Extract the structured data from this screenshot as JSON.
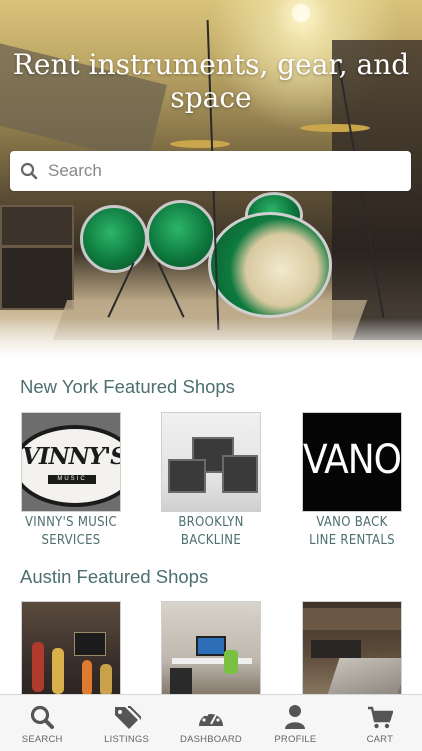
{
  "hero": {
    "title": "Rent instruments, gear, and space"
  },
  "search": {
    "placeholder": "Search",
    "icon": "search-icon"
  },
  "sections": [
    {
      "title": "New York Featured Shops",
      "shops": [
        {
          "name": "VINNY'S MUSIC SERVICES",
          "logo_text": "VINNY'S",
          "logo_sub": "MUSIC"
        },
        {
          "name": "BROOKLYN BACKLINE"
        },
        {
          "name": "VANO BACK LINE RENTALS",
          "logo_text": "VANO"
        }
      ]
    },
    {
      "title": "Austin Featured Shops",
      "shops": [
        {
          "name": ""
        },
        {
          "name": ""
        },
        {
          "name": ""
        }
      ]
    }
  ],
  "tabbar": {
    "items": [
      {
        "label": "SEARCH",
        "icon": "search-icon"
      },
      {
        "label": "LISTINGS",
        "icon": "tags-icon"
      },
      {
        "label": "DASHBOARD",
        "icon": "dashboard-icon"
      },
      {
        "label": "PROFILE",
        "icon": "profile-icon"
      },
      {
        "label": "CART",
        "icon": "cart-icon"
      }
    ]
  },
  "colors": {
    "accent_text": "#4d6f6f",
    "tab_icon": "#555555"
  }
}
